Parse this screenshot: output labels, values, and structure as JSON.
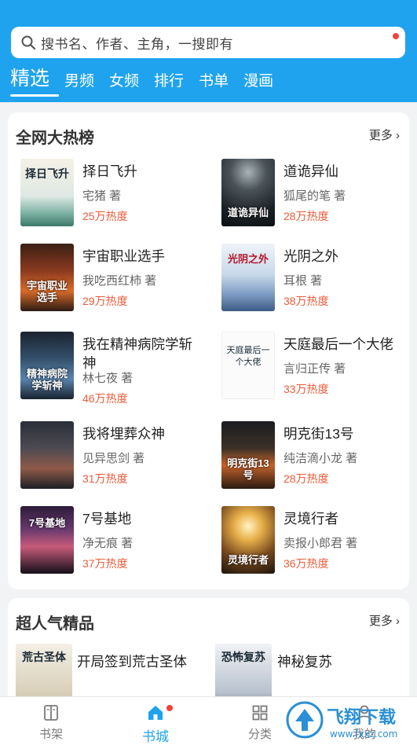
{
  "search": {
    "placeholder": "搜书名、作者、主角，一搜即有"
  },
  "tabs": [
    "精选",
    "男频",
    "女频",
    "排行",
    "书单",
    "漫画"
  ],
  "hot": {
    "title": "全网大热榜",
    "more": "更多",
    "books": [
      {
        "title": "择日飞升",
        "author": "宅猪 著",
        "heat": "25万热度",
        "cover_text": "择日飞升"
      },
      {
        "title": "道诡异仙",
        "author": "狐尾的笔 著",
        "heat": "28万热度",
        "cover_text": "道诡异仙"
      },
      {
        "title": "宇宙职业选手",
        "author": "我吃西红柿 著",
        "heat": "29万热度",
        "cover_text": "宇宙职业选手"
      },
      {
        "title": "光阴之外",
        "author": "耳根 著",
        "heat": "38万热度",
        "cover_text": "光阴之外"
      },
      {
        "title": "我在精神病院学斩神",
        "author": "林七夜 著",
        "heat": "46万热度",
        "cover_text": "精神病院学斩神"
      },
      {
        "title": "天庭最后一个大佬",
        "author": "言归正传 著",
        "heat": "33万热度",
        "cover_text": "天庭最后一个大佬"
      },
      {
        "title": "我将埋葬众神",
        "author": "见异思剑 著",
        "heat": "31万热度",
        "cover_text": ""
      },
      {
        "title": "明克街13号",
        "author": "纯洁滴小龙 著",
        "heat": "28万热度",
        "cover_text": "明克街13号"
      },
      {
        "title": "7号基地",
        "author": "净无痕 著",
        "heat": "37万热度",
        "cover_text": "7号基地"
      },
      {
        "title": "灵境行者",
        "author": "卖报小郎君 著",
        "heat": "36万热度",
        "cover_text": "灵境行者"
      }
    ]
  },
  "popular": {
    "title": "超人气精品",
    "more": "更多",
    "books": [
      {
        "title": "开局签到荒古圣体",
        "cover_text": "荒古圣体"
      },
      {
        "title": "神秘复苏",
        "cover_text": "恐怖复苏"
      }
    ]
  },
  "nav": [
    {
      "label": "书架",
      "icon": "bookshelf-icon"
    },
    {
      "label": "书城",
      "icon": "home-icon"
    },
    {
      "label": "分类",
      "icon": "grid-icon"
    },
    {
      "label": "我的",
      "icon": "user-icon"
    }
  ],
  "watermark": {
    "text": "飞翔下载",
    "sub": "www.fxxz.com"
  },
  "colors": {
    "primary": "#1fa3ee",
    "heat": "#ee5a38",
    "badge": "#f0443a"
  }
}
